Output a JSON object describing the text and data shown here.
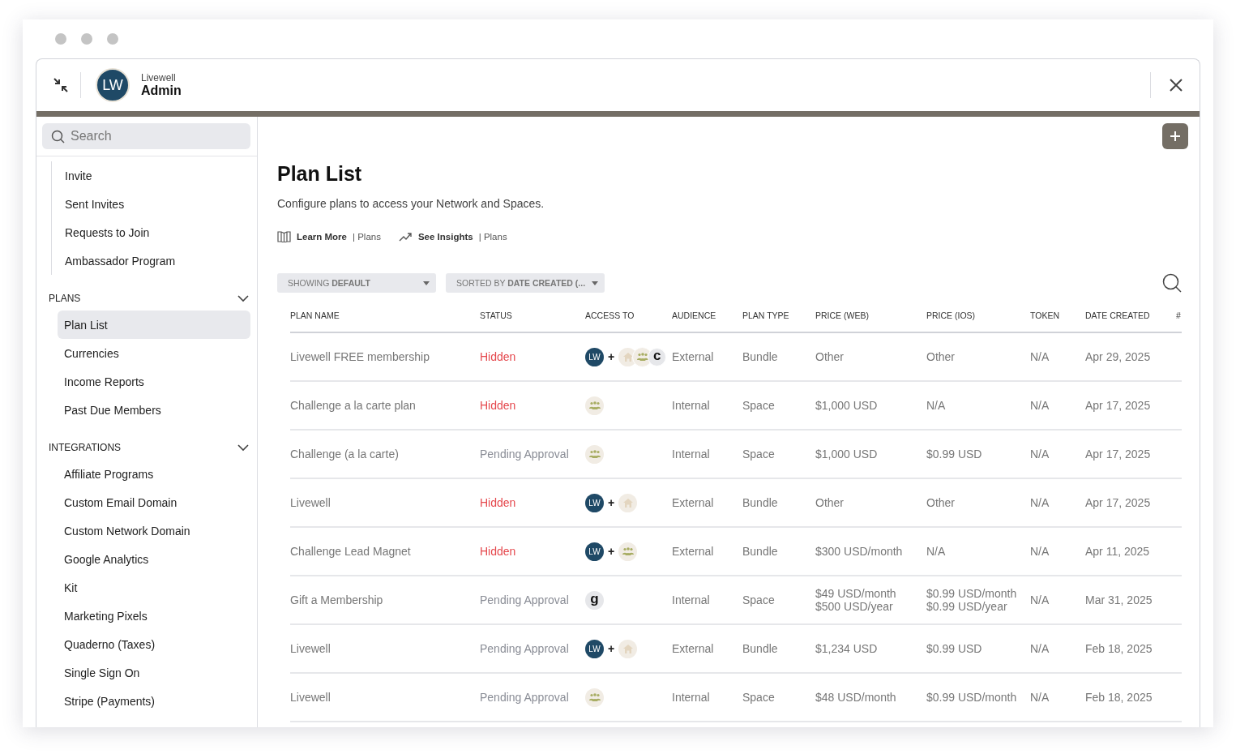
{
  "app": {
    "brand_small": "Livewell",
    "brand_title": "Admin",
    "logo_text": "LW"
  },
  "search": {
    "placeholder": "Search"
  },
  "sidebar": {
    "groups": [
      {
        "items": [
          {
            "label": "Invite",
            "selected": false
          },
          {
            "label": "Sent Invites",
            "selected": false
          },
          {
            "label": "Requests to Join",
            "selected": false
          },
          {
            "label": "Ambassador Program",
            "selected": false
          }
        ]
      },
      {
        "title": "PLANS",
        "expanded": true,
        "items": [
          {
            "label": "Plan List",
            "selected": true
          },
          {
            "label": "Currencies",
            "selected": false
          },
          {
            "label": "Income Reports",
            "selected": false
          },
          {
            "label": "Past Due Members",
            "selected": false
          }
        ]
      },
      {
        "title": "INTEGRATIONS",
        "expanded": true,
        "items": [
          {
            "label": "Affiliate Programs",
            "selected": false
          },
          {
            "label": "Custom Email Domain",
            "selected": false
          },
          {
            "label": "Custom Network Domain",
            "selected": false
          },
          {
            "label": "Google Analytics",
            "selected": false
          },
          {
            "label": "Kit",
            "selected": false
          },
          {
            "label": "Marketing Pixels",
            "selected": false
          },
          {
            "label": "Quaderno (Taxes)",
            "selected": false
          },
          {
            "label": "Single Sign On",
            "selected": false
          },
          {
            "label": "Stripe (Payments)",
            "selected": false
          }
        ]
      }
    ]
  },
  "page": {
    "title": "Plan List",
    "subtitle": "Configure plans to access your Network and Spaces.",
    "links": [
      {
        "kind": "book",
        "bold": "Learn More",
        "rest": "| Plans"
      },
      {
        "kind": "trend",
        "bold": "See Insights",
        "rest": "| Plans"
      }
    ],
    "filters": [
      {
        "prefix": "SHOWING",
        "value": "DEFAULT"
      },
      {
        "prefix": "SORTED BY",
        "value": "DATE CREATED (..."
      }
    ]
  },
  "table": {
    "columns": [
      "PLAN NAME",
      "STATUS",
      "ACCESS TO",
      "AUDIENCE",
      "PLAN TYPE",
      "PRICE (WEB)",
      "PRICE (IOS)",
      "TOKEN",
      "DATE CREATED",
      "#"
    ],
    "rows": [
      {
        "name": "Livewell FREE membership",
        "status": "Hidden",
        "alert": true,
        "access": [
          {
            "kind": "logo",
            "text": "LW"
          },
          {
            "kind": "plus",
            "text": "+"
          },
          {
            "kind": "home"
          },
          {
            "kind": "group"
          },
          {
            "kind": "letter",
            "text": "c"
          }
        ],
        "audience": "External",
        "type": "Bundle",
        "web": [
          "Other"
        ],
        "ios": [
          "Other"
        ],
        "token": "N/A",
        "date": "Apr 29, 2025"
      },
      {
        "name": "Challenge a la carte plan",
        "status": "Hidden",
        "alert": true,
        "access": [
          {
            "kind": "group"
          }
        ],
        "audience": "Internal",
        "type": "Space",
        "web": [
          "$1,000 USD"
        ],
        "ios": [
          "N/A"
        ],
        "token": "N/A",
        "date": "Apr 17, 2025"
      },
      {
        "name": "Challenge (a la carte)",
        "status": "Pending Approval",
        "alert": false,
        "access": [
          {
            "kind": "group"
          }
        ],
        "audience": "Internal",
        "type": "Space",
        "web": [
          "$1,000 USD"
        ],
        "ios": [
          "$0.99 USD"
        ],
        "token": "N/A",
        "date": "Apr 17, 2025"
      },
      {
        "name": "Livewell",
        "status": "Hidden",
        "alert": true,
        "access": [
          {
            "kind": "logo",
            "text": "LW"
          },
          {
            "kind": "plus",
            "text": "+"
          },
          {
            "kind": "home"
          }
        ],
        "audience": "External",
        "type": "Bundle",
        "web": [
          "Other"
        ],
        "ios": [
          "Other"
        ],
        "token": "N/A",
        "date": "Apr 17, 2025"
      },
      {
        "name": "Challenge Lead Magnet",
        "status": "Hidden",
        "alert": true,
        "access": [
          {
            "kind": "logo",
            "text": "LW"
          },
          {
            "kind": "plus",
            "text": "+"
          },
          {
            "kind": "group"
          }
        ],
        "audience": "External",
        "type": "Bundle",
        "web": [
          "$300 USD/month"
        ],
        "ios": [
          "N/A"
        ],
        "token": "N/A",
        "date": "Apr 11, 2025"
      },
      {
        "name": "Gift a Membership",
        "status": "Pending Approval",
        "alert": false,
        "access": [
          {
            "kind": "letter",
            "text": "g"
          }
        ],
        "audience": "Internal",
        "type": "Space",
        "web": [
          "$49 USD/month",
          "$500 USD/year"
        ],
        "ios": [
          "$0.99 USD/month",
          "$0.99 USD/year"
        ],
        "token": "N/A",
        "date": "Mar 31, 2025"
      },
      {
        "name": "Livewell",
        "status": "Pending Approval",
        "alert": false,
        "access": [
          {
            "kind": "logo",
            "text": "LW"
          },
          {
            "kind": "plus",
            "text": "+"
          },
          {
            "kind": "home"
          }
        ],
        "audience": "External",
        "type": "Bundle",
        "web": [
          "$1,234 USD"
        ],
        "ios": [
          "$0.99 USD"
        ],
        "token": "N/A",
        "date": "Feb 18, 2025"
      },
      {
        "name": "Livewell",
        "status": "Pending Approval",
        "alert": false,
        "access": [
          {
            "kind": "group"
          }
        ],
        "audience": "Internal",
        "type": "Space",
        "web": [
          "$48 USD/month"
        ],
        "ios": [
          "$0.99 USD/month"
        ],
        "token": "N/A",
        "date": "Feb 18, 2025"
      }
    ]
  }
}
